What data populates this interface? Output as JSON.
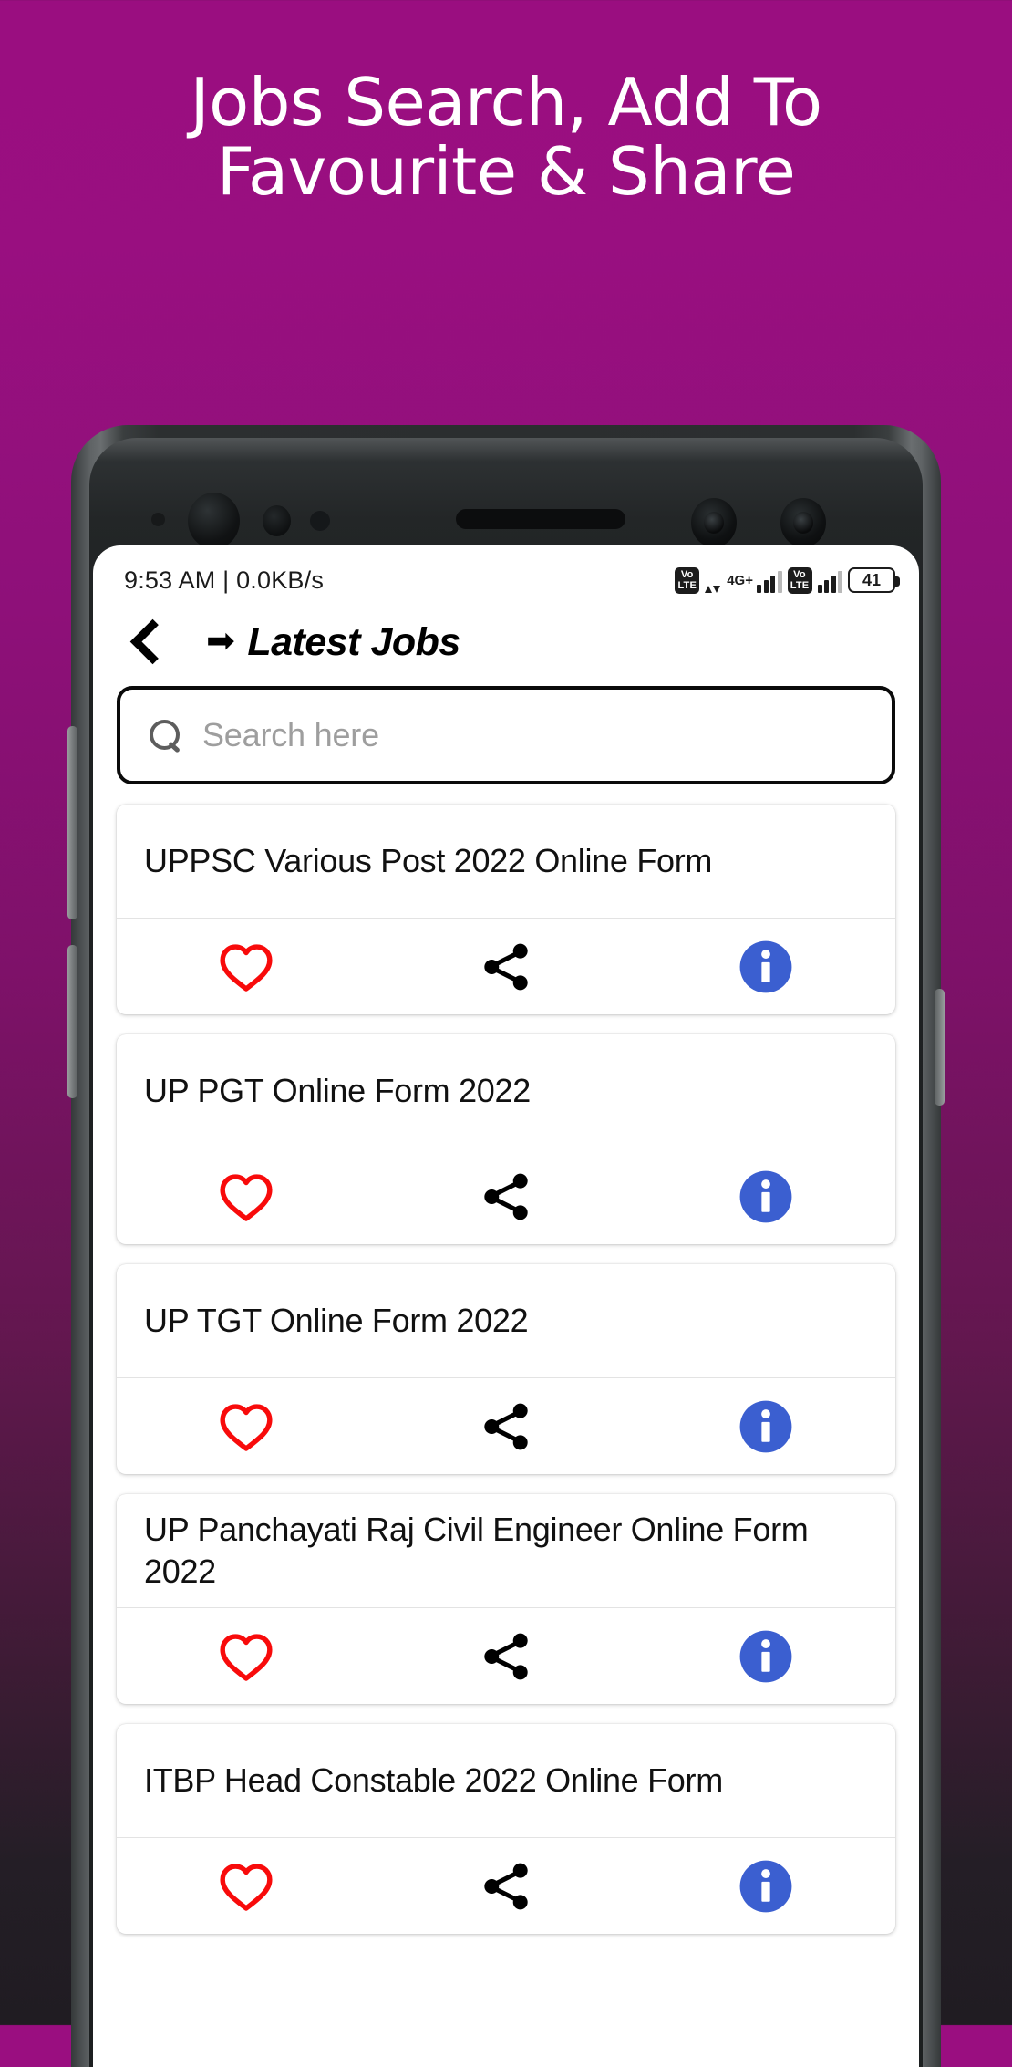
{
  "promo": {
    "headline_line1": "Jobs Search, Add To",
    "headline_line2": "Favourite & Share",
    "background_top_color": "#9A0E80",
    "background_bottom_color": "#201C22"
  },
  "status_bar": {
    "time_and_net": "9:53 AM | 0.0KB/s",
    "volte_top": "Vo",
    "volte_bottom": "LTE",
    "network_type": "4G+",
    "battery_level": "41"
  },
  "app_bar": {
    "back_icon": "chevron-left-icon",
    "arrow_glyph": "➡",
    "title": "Latest Jobs"
  },
  "search": {
    "icon": "search-icon",
    "placeholder": "Search here",
    "value": ""
  },
  "action_icons": {
    "favourite": "heart-outline-icon",
    "share": "share-icon",
    "info": "info-circle-icon",
    "favourite_color": "#F80B0B",
    "share_color": "#000000",
    "info_color": "#3B5FD0"
  },
  "jobs": [
    {
      "title": "UPPSC Various Post 2022 Online Form"
    },
    {
      "title": "UP PGT Online Form 2022"
    },
    {
      "title": "UP TGT Online Form 2022"
    },
    {
      "title": "UP Panchayati Raj Civil Engineer Online Form 2022"
    },
    {
      "title": "ITBP Head Constable 2022 Online Form"
    }
  ]
}
